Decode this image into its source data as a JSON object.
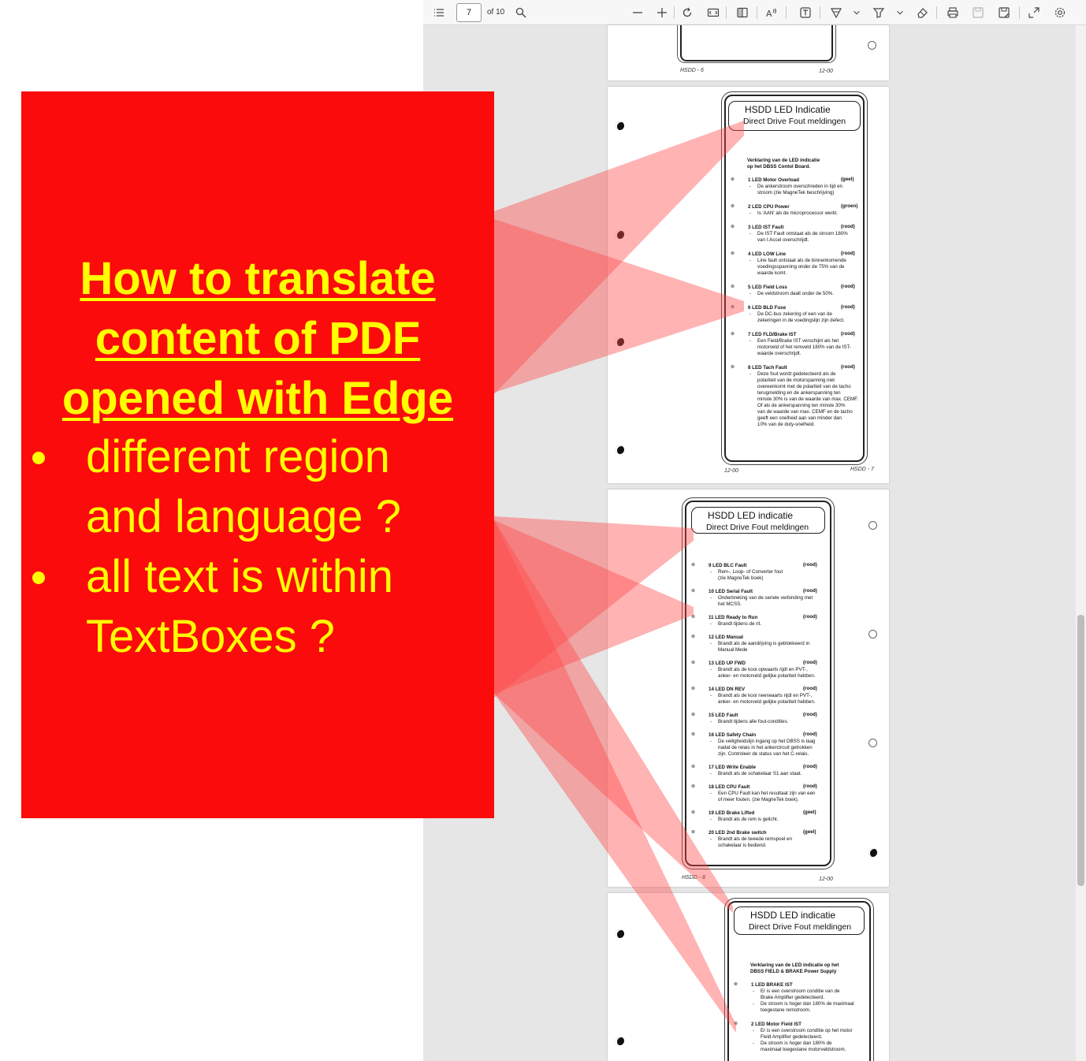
{
  "toolbar": {
    "page_number": "7",
    "page_total": "of 10",
    "icons": [
      "contents-icon",
      "search-icon",
      "zoom-out-icon",
      "zoom-in-icon",
      "rotate-icon",
      "fit-page-icon",
      "page-view-icon",
      "read-aloud-icon",
      "text-box-icon",
      "draw-icon",
      "draw-dropdown-icon",
      "highlight-icon",
      "highlight-dropdown-icon",
      "eraser-icon",
      "print-icon",
      "save-icon",
      "save-as-icon",
      "fullscreen-icon",
      "settings-icon"
    ]
  },
  "overlay": {
    "headline": [
      "How to translate",
      "content of PDF",
      "opened with Edge"
    ],
    "questions": [
      [
        "different region",
        "and language ?"
      ],
      [
        "all text is within",
        "TextBoxes ?"
      ]
    ],
    "colors": {
      "panel": "#fb0b0b",
      "text": "#ffff00",
      "beam": "#ff5a5a"
    }
  },
  "pages": {
    "p6_footer": {
      "left": "HSDD - 6",
      "right": "12-00"
    },
    "p7": {
      "header_1": "HSDD     LED Indicatie",
      "header_2": "Direct Drive Fout meldingen",
      "intro": [
        "Verklaring van de LED indicatie",
        "op het DBSS Contol Board."
      ],
      "items": [
        {
          "t": "1 LED  Motor Overload",
          "c": "(geel)",
          "d": [
            "De ankerstroom overschreden in tijd en",
            "stroom (zie MagneTek beschrijving)"
          ]
        },
        {
          "t": "2 LED  CPU Power",
          "c": "(groen)",
          "d": [
            "Is 'AAN' als de microprocessor werkt."
          ]
        },
        {
          "t": "3 LED  IST Fault",
          "c": "(rood)",
          "d": [
            "De IST Fault ontstaat als de stroom 180%",
            "van I.Accel overschrijdt."
          ]
        },
        {
          "t": "4 LED  LOW Line",
          "c": "(rood)",
          "d": [
            "Line fault ontstaat als de binnenkomende",
            "voedingsspanning onder de 75% van de",
            "waarde komt."
          ]
        },
        {
          "t": "5 LED  Field Loss",
          "c": "(rood)",
          "d": [
            "De veldstroom daalt onder de 50%."
          ]
        },
        {
          "t": "6 LED  BLD Fuse",
          "c": "(rood)",
          "d": [
            "De DC-bus zekering of een van de",
            "zekeringen in de voedingslijn zijn defect."
          ]
        },
        {
          "t": "7 LED  FLD/Brake IST",
          "c": "(rood)",
          "d": [
            "Een Field/Brake IST verschijnt als het",
            "motorveld of het remveld 180% van de IST-",
            "waarde overschrijdt."
          ]
        },
        {
          "t": "8 LED  Tach Fault",
          "c": "(rood)",
          "d": [
            "Deze fout wordt gedetecteerd als de",
            "polariteit van de motorspanning niet",
            "overeenkomt met  de polariteit van de tacho",
            "terugmelding en de ankerspanning ten",
            "minste 30% is van de waarde van max. CEMF.",
            "Of als de ankerspanning ten minste 30%",
            "van de waarde van max. CEMF en de tacho",
            "geeft een snelheid  aan van minder dan",
            "10% van de duty-snelheid."
          ]
        }
      ],
      "footer": {
        "left": "12-00",
        "right": "HSDD - 7"
      }
    },
    "p8": {
      "header_1": "HSDD     LED indicatie",
      "header_2": "Direct Drive Fout meldingen",
      "items": [
        {
          "t": "9 LED  BLC Fault",
          "c": "(rood)",
          "d": [
            "Rem-, Loop- of Converter fout",
            "(zie MagneTek boek)"
          ]
        },
        {
          "t": "10 LED Serial Fault",
          "c": "(rood)",
          "d": [
            "Onderbreking van de seriele verbinding met",
            "het MCSS."
          ]
        },
        {
          "t": "11 LED Ready to Run",
          "c": "(rood)",
          "d": [
            "Brandt tijdens de rit."
          ]
        },
        {
          "t": "12 LED Manual",
          "c": "",
          "d": [
            "Brandt als de aandrijving is geblokkeerd in",
            "Manual Mede"
          ]
        },
        {
          "t": "13 LED UP FWD",
          "c": "(rood)",
          "d": [
            "Brandt als de kooi opwaarts rijdt en PVT-,",
            "anker- en motorveld gelijke polariteit hebben."
          ]
        },
        {
          "t": "14 LED DN REV",
          "c": "(rood)",
          "d": [
            "Brandt als de kooi neerwaarts rijdt en PVT-,",
            "anker- en motorveld gelijke polariteit hebben."
          ]
        },
        {
          "t": "15 LED Fault",
          "c": "(rood)",
          "d": [
            "Brandt tijdens alle fout-condities."
          ]
        },
        {
          "t": "16 LED Safety Chain",
          "c": "(rood)",
          "d": [
            "De veiligheidslijn ingang op het DBSS is laag",
            "nadat de relais in het ankercircuit getrokken",
            "zijn. Controleer de status van het C-relais."
          ]
        },
        {
          "t": "17 LED Write Enable",
          "c": "(rood)",
          "d": [
            "Brandt als de schakelaar S1 aan staat."
          ]
        },
        {
          "t": "18 LED CPU Fault",
          "c": "(rood)",
          "d": [
            "Een CPU Fault kan het resultaat zijn van een",
            "of meer fouten. (zie MagneTek boek)."
          ]
        },
        {
          "t": "19 LED Brake Lifted",
          "c": "(geel)",
          "d": [
            "Brandt als de rem is gelicht."
          ]
        },
        {
          "t": "20 LED 2nd Brake switch",
          "c": "(geel)",
          "d": [
            "Brandt als de tweede remspoel en",
            "schakelaar is bediend."
          ]
        }
      ],
      "footer": {
        "left": "HSDD - 8",
        "right": "12-00"
      }
    },
    "p9": {
      "header_1": "HSDD     LED indicatie",
      "header_2": "Direct Drive Fout meldingen",
      "intro": [
        "Verklaring van de LED indicatie op het",
        "DBSS FIELD & BRAKE Power Supply"
      ],
      "items": [
        {
          "t": "1 LED BRAKE IST",
          "c": "",
          "d": [
            "Er is een overstroom conditie van de",
            "Brake  Amplifier gedetecteerd.",
            "De stroom is hoger dan 180% de maximaal",
            "toegestane remstroom."
          ]
        },
        {
          "t": "2 LED  Motor Field IST",
          "c": "",
          "d": [
            "Er is een overstroom conditie op het motor",
            "Field Amplifier gedetecteerd.",
            "De stroom is hoger dan 180% de",
            "maximaal toegestane motorveldstroom."
          ]
        }
      ]
    }
  }
}
